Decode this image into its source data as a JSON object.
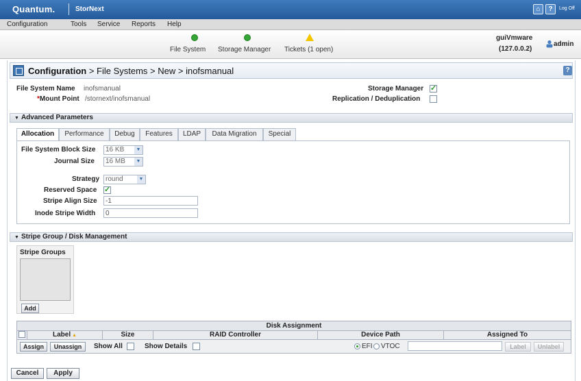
{
  "app": {
    "brand": "Quantum.",
    "product": "StorNext",
    "logoff": "Log Off"
  },
  "menu": [
    "Configuration",
    "Tools",
    "Service",
    "Reports",
    "Help"
  ],
  "status": {
    "items": [
      {
        "label": "File System",
        "icon": "ok-icon"
      },
      {
        "label": "Storage Manager",
        "icon": "ok-icon"
      },
      {
        "label": "Tickets (1 open)",
        "icon": "warning-icon"
      }
    ],
    "host": "guiVmware",
    "host_ip": "(127.0.0.2)",
    "user": "admin"
  },
  "page": {
    "title_bold": "Configuration",
    "title_rest": " > File Systems > New > inofsmanual"
  },
  "fs": {
    "name_label": "File System Name",
    "name_value": "inofsmanual",
    "mount_req": "*",
    "mount_label": "Mount Point",
    "mount_value": "/stornext/inofsmanual",
    "sm_label": "Storage Manager",
    "sm_checked": true,
    "rep_label": "Replication / Deduplication",
    "rep_checked": false
  },
  "advanced": {
    "title": "Advanced Parameters",
    "tabs": [
      "Allocation",
      "Performance",
      "Debug",
      "Features",
      "LDAP",
      "Data Migration",
      "Special"
    ],
    "active_tab": "Allocation",
    "block_size_label": "File System Block Size",
    "block_size_value": "16 KB",
    "journal_label": "Journal Size",
    "journal_value": "16 MB",
    "strategy_label": "Strategy",
    "strategy_value": "round",
    "reserved_label": "Reserved Space",
    "reserved_checked": true,
    "stripe_align_label": "Stripe Align Size",
    "stripe_align_value": "-1",
    "inode_label": "Inode Stripe Width",
    "inode_value": "0"
  },
  "stripe": {
    "title": "Stripe Group / Disk Management",
    "groups_label": "Stripe Groups",
    "add": "Add"
  },
  "disk": {
    "title": "Disk Assignment",
    "columns": [
      "Label",
      "Size",
      "RAID Controller",
      "Device Path",
      "Assigned To"
    ],
    "assign": "Assign",
    "unassign": "Unassign",
    "show_all": "Show All",
    "show_details": "Show Details",
    "efi": "EFI",
    "vtoc": "VTOC",
    "label_btn": "Label",
    "unlabel_btn": "Unlabel"
  },
  "actions": {
    "cancel": "Cancel",
    "apply": "Apply"
  },
  "colors": {
    "titlebar": "#2f6aad",
    "ok": "#35a535",
    "warning": "#f3c600"
  }
}
